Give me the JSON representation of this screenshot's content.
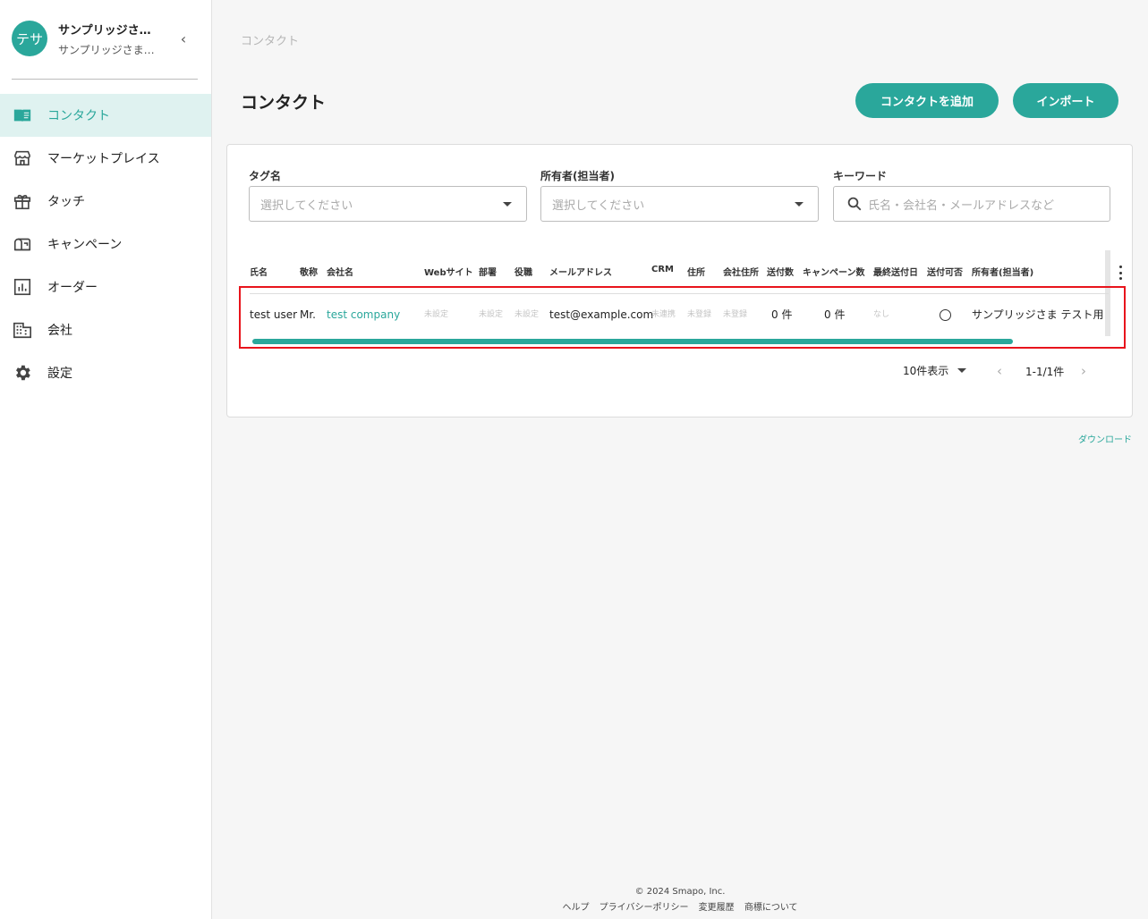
{
  "sidebar": {
    "avatar_text": "テサ",
    "account_name": "サンプリッジさまテスト用",
    "account_sub": "サンプリッジさまテスト用",
    "items": [
      {
        "label": "コンタクト",
        "icon": "book-icon"
      },
      {
        "label": "マーケットプレイス",
        "icon": "store-icon"
      },
      {
        "label": "タッチ",
        "icon": "gift-icon"
      },
      {
        "label": "キャンペーン",
        "icon": "mailbox-icon"
      },
      {
        "label": "オーダー",
        "icon": "chart-icon"
      },
      {
        "label": "会社",
        "icon": "building-icon"
      },
      {
        "label": "設定",
        "icon": "gear-icon"
      }
    ],
    "active_index": 0
  },
  "breadcrumb": "コンタクト",
  "page_title": "コンタクト",
  "buttons": {
    "add": "コンタクトを追加",
    "import": "インポート"
  },
  "filters": {
    "tag_label": "タグ名",
    "tag_placeholder": "選択してください",
    "owner_label": "所有者(担当者)",
    "owner_placeholder": "選択してください",
    "keyword_label": "キーワード",
    "keyword_placeholder": "氏名・会社名・メールアドレスなど"
  },
  "table": {
    "columns": [
      "氏名",
      "敬称",
      "会社名",
      "Webサイト",
      "部署",
      "役職",
      "メールアドレス",
      "CRM",
      "住所",
      "会社住所",
      "送付数",
      "キャンペーン数",
      "最終送付日",
      "送付可否",
      "所有者(担当者)"
    ],
    "rows": [
      {
        "name": "test user",
        "honorific": "Mr.",
        "company": "test company",
        "website": "未設定",
        "department": "未設定",
        "position": "未設定",
        "email": "test@example.com",
        "crm": "未連携",
        "address": "未登録",
        "company_address": "未登録",
        "sent_count": "0 件",
        "campaign_count": "0 件",
        "last_sent": "なし",
        "owner": "サンプリッジさま テスト用"
      }
    ]
  },
  "pager": {
    "page_size": "10件表示",
    "range": "1-1/1件"
  },
  "download": "ダウンロード",
  "footer": {
    "copyright": "© 2024 Smapo, Inc.",
    "links": [
      "ヘルプ",
      "プライバシーポリシー",
      "変更履歴",
      "商標について"
    ]
  },
  "colors": {
    "accent": "#2aa79b",
    "highlight": "#e8141c"
  }
}
